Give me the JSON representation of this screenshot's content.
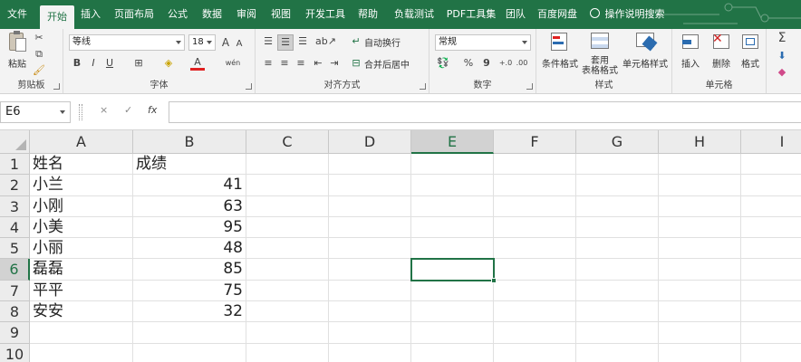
{
  "tabs": [
    "文件",
    "开始",
    "插入",
    "页面布局",
    "公式",
    "数据",
    "审阅",
    "视图",
    "开发工具",
    "帮助",
    "负载测试",
    "PDF工具集",
    "团队",
    "百度网盘",
    "操作说明搜索"
  ],
  "ribbon": {
    "clipboard": {
      "paste_label": "粘贴",
      "group_label": "剪贴板"
    },
    "font": {
      "font_name": "等线",
      "font_size": "18",
      "bold": "B",
      "italic": "I",
      "underline": "U",
      "grow": "A",
      "shrink": "A",
      "phonetic": "wén",
      "group_label": "字体"
    },
    "alignment": {
      "wrap_label": "自动换行",
      "merge_label": "合并后居中",
      "group_label": "对齐方式"
    },
    "number": {
      "format": "常规",
      "percent": "%",
      "comma": "9",
      "group_label": "数字"
    },
    "styles": {
      "conditional_label": "条件格式",
      "table_label_1": "套用",
      "table_label_2": "表格格式",
      "cell_styles_label": "单元格样式",
      "group_label": "样式"
    },
    "cells": {
      "insert_label": "插入",
      "delete_label": "删除",
      "format_label": "格式",
      "group_label": "单元格"
    },
    "editing": {
      "sum_symbol": "Σ"
    }
  },
  "formula_bar": {
    "name_box": "E6",
    "cancel": "×",
    "enter": "✓",
    "fx": "fx",
    "formula": ""
  },
  "sheet": {
    "columns": [
      "A",
      "B",
      "C",
      "D",
      "E",
      "F",
      "G",
      "H",
      "I"
    ],
    "rows": [
      "1",
      "2",
      "3",
      "4",
      "5",
      "6",
      "7",
      "8",
      "9",
      "10"
    ],
    "cells": [
      {
        "name": "姓名",
        "score": "成绩"
      },
      {
        "name": "小兰",
        "score": "41"
      },
      {
        "name": "小刚",
        "score": "63"
      },
      {
        "name": "小美",
        "score": "95"
      },
      {
        "name": "小丽",
        "score": "48"
      },
      {
        "name": "磊磊",
        "score": "85"
      },
      {
        "name": "平平",
        "score": "75"
      },
      {
        "name": "安安",
        "score": "32"
      }
    ],
    "active_cell": "E6"
  },
  "colors": {
    "accent": "#217346",
    "ribbon_bg": "#f3f3f3",
    "header_bg": "#ececec",
    "gridline": "#e0e0e0"
  }
}
